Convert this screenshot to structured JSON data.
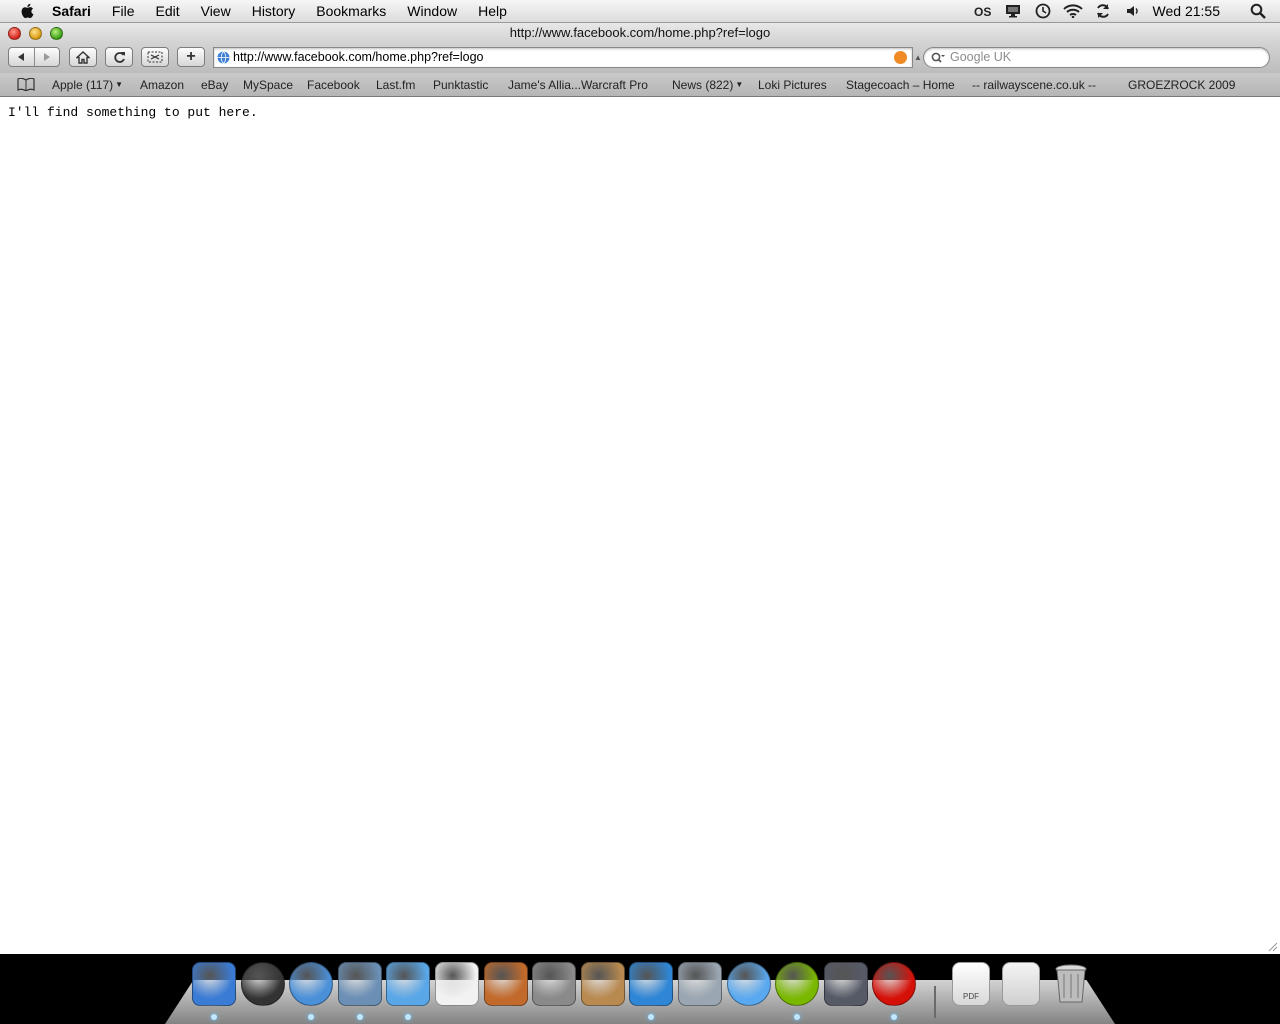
{
  "menubar": {
    "app_name": "Safari",
    "menus": [
      "File",
      "Edit",
      "View",
      "History",
      "Bookmarks",
      "Window",
      "Help"
    ],
    "status_icons": [
      "lastfm-icon",
      "display-icon",
      "time-machine-icon",
      "wifi-icon",
      "sync-icon",
      "volume-icon"
    ],
    "clock": "Wed 21:55"
  },
  "window": {
    "title": "http://www.facebook.com/home.php?ref=logo"
  },
  "toolbar": {
    "url": "http://www.facebook.com/home.php?ref=logo",
    "search_placeholder": "Google UK",
    "add_bookmark_label": "+"
  },
  "bookmarks_bar": {
    "items": [
      {
        "label": "Apple (117)",
        "has_menu": true
      },
      {
        "label": "Amazon",
        "has_menu": false
      },
      {
        "label": "eBay",
        "has_menu": false
      },
      {
        "label": "MySpace",
        "has_menu": false
      },
      {
        "label": "Facebook",
        "has_menu": false
      },
      {
        "label": "Last.fm",
        "has_menu": false
      },
      {
        "label": "Punktastic",
        "has_menu": false
      },
      {
        "label": "Jame's Allia...Warcraft Pro",
        "has_menu": false
      },
      {
        "label": "News (822)",
        "has_menu": true
      },
      {
        "label": "Loki Pictures",
        "has_menu": false
      },
      {
        "label": "Stagecoach – Home",
        "has_menu": false
      },
      {
        "label": "-- railwayscene.co.uk --",
        "has_menu": false
      },
      {
        "label": "GROEZROCK 2009",
        "has_menu": false
      }
    ]
  },
  "page": {
    "body_text": "I'll find something to put here."
  },
  "dock": {
    "apps": [
      {
        "name": "finder-icon",
        "color": "#3a7bd5",
        "running": true
      },
      {
        "name": "dashboard-icon",
        "color": "#333333",
        "running": false
      },
      {
        "name": "safari-icon",
        "color": "#4a90d9",
        "running": true
      },
      {
        "name": "mail-icon",
        "color": "#6b8fb5",
        "running": true
      },
      {
        "name": "itunes-icon",
        "color": "#5aa7e8",
        "running": true
      },
      {
        "name": "ical-icon",
        "color": "#f2f2f2",
        "running": false
      },
      {
        "name": "iphoto-icon",
        "color": "#c26a2b",
        "running": false
      },
      {
        "name": "system-preferences-icon",
        "color": "#8a8a8a",
        "running": false
      },
      {
        "name": "preview-icon",
        "color": "#b98a50",
        "running": false
      },
      {
        "name": "messenger-icon",
        "color": "#2f86d6",
        "running": true
      },
      {
        "name": "photo-booth-icon",
        "color": "#9aa6b2",
        "running": false
      },
      {
        "name": "ichat-icon",
        "color": "#5aa9f0",
        "running": false
      },
      {
        "name": "spotify-icon",
        "color": "#7ab800",
        "running": true
      },
      {
        "name": "script-editor-icon",
        "color": "#555a66",
        "running": false
      },
      {
        "name": "lastfm-app-icon",
        "color": "#d51007",
        "running": true
      }
    ],
    "docs": [
      {
        "name": "pdf-document-icon",
        "label": "PDF"
      },
      {
        "name": "documents-stack-icon",
        "label": ""
      },
      {
        "name": "trash-icon",
        "label": ""
      }
    ]
  }
}
